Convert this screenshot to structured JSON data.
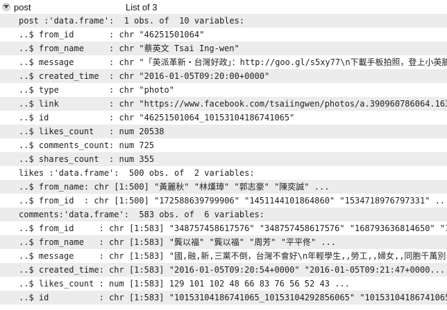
{
  "header": {
    "name": "post",
    "type": "List of 3",
    "toggle_icon": "expand-triangle-icon"
  },
  "rows": [
    "post :'data.frame':  1 obs. of  10 variables:",
    "..$ from_id       : chr \"46251501064\"",
    "..$ from_name     : chr \"蔡英文 Tsai Ing-wen\"",
    "..$ message       : chr \"「英派革新・台灣好政」：http://goo.gl/s5xy77\\n下載手板拍照，登上小英臉...",
    "..$ created_time  : chr \"2016-01-05T09:20:00+0000\"",
    "..$ type          : chr \"photo\"",
    "..$ link          : chr \"https://www.facebook.com/tsaiingwen/photos/a.390960786064.163647.4...",
    "..$ id            : chr \"46251501064_10153104186741065\"",
    "..$ likes_count   : num 20538",
    "..$ comments_count: num 725",
    "..$ shares_count  : num 355",
    "likes :'data.frame':  500 obs. of  2 variables:",
    "..$ from_name: chr [1:500] \"黃麗秋\" \"林熯璋\" \"郭志豪\" \"陳奕誠\" ...",
    "..$ from_id  : chr [1:500] \"172588639799906\" \"1451144101864860\" \"1534718976797331\" ...",
    "comments:'data.frame':  583 obs. of  6 variables:",
    "..$ from_id     : chr [1:583] \"348757458617576\" \"348757458617576\" \"168793636814650\" \"1...",
    "..$ from_name   : chr [1:583] \"龔以福\" \"龔以福\" \"周芳\" \"平平佟\" ...",
    "..$ message     : chr [1:583] \"國,融,新,三黨不倒，台灣不會好\\n年輕學生,,勞工,,婦女,,同胞千萬別...",
    "..$ created_time: chr [1:583] \"2016-01-05T09:20:54+0000\" \"2016-01-05T09:21:47+0000...",
    "..$ likes_count : num [1:583] 129 101 102 48 66 83 76 56 52 43 ...",
    "..$ id          : chr [1:583] \"10153104186741065_10153104292856065\" \"10153104186741065_1015..."
  ]
}
